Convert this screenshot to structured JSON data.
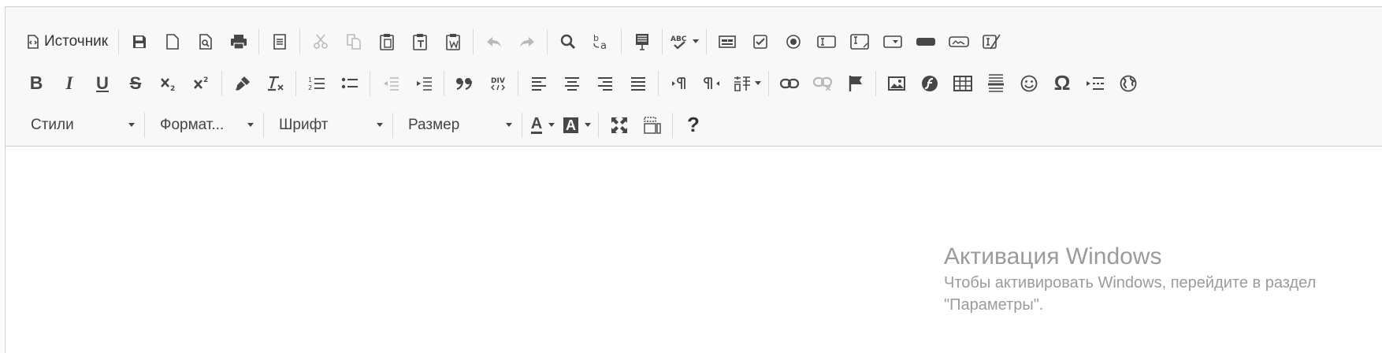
{
  "toolbar": {
    "source_label": "Источник",
    "combos": {
      "styles": "Стили",
      "format": "Формат...",
      "font": "Шрифт",
      "size": "Размер"
    },
    "text_buttons": {
      "bold": "B",
      "italic": "I",
      "underline": "U",
      "strike": "S",
      "help": "?",
      "text_color": "A",
      "bg_color": "A",
      "omega": "Ω"
    }
  },
  "watermark": {
    "title": "Активация Windows",
    "line1": "Чтобы активировать Windows, перейдите в раздел",
    "line2": "\"Параметры\"."
  },
  "colors": {
    "toolbar_bg": "#f8f8f8",
    "border": "#d1d1d1",
    "icon": "#474747",
    "icon_disabled": "#c6c6c6",
    "watermark": "#9b9b9b"
  }
}
